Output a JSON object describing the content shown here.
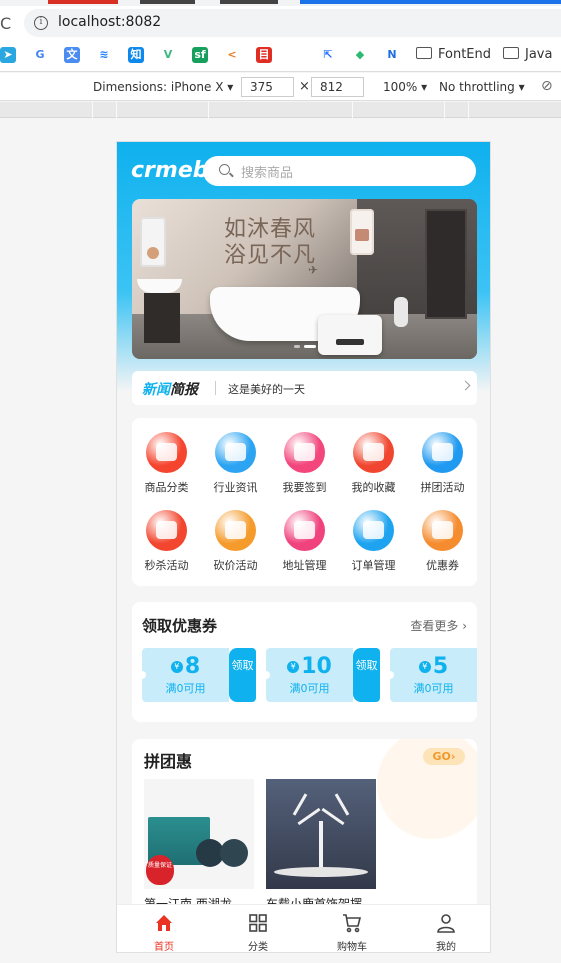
{
  "browser": {
    "url": "localhost:8082",
    "bookmarks": [
      "FontEnd",
      "Java"
    ]
  },
  "devtools": {
    "device_label": "Dimensions: iPhone X ▾",
    "width": "375",
    "times": "×",
    "height": "812",
    "zoom": "100% ▾",
    "throttle": "No throttling ▾"
  },
  "app": {
    "logo": "crmeb",
    "search": {
      "placeholder": "搜索商品"
    },
    "banner": {
      "line1": "如沐春风",
      "line2": "浴见不凡"
    },
    "news": {
      "brand_a": "新闻",
      "brand_b": "简报",
      "text": "这是美好的一天"
    },
    "menu": [
      {
        "label": "商品分类",
        "color": "#f5452f",
        "icon": "bag-icon"
      },
      {
        "label": "行业资讯",
        "color": "#2ca4f2",
        "icon": "news-doc-icon"
      },
      {
        "label": "我要签到",
        "color": "#f2467c",
        "icon": "calendar-icon"
      },
      {
        "label": "我的收藏",
        "color": "#f0462f",
        "icon": "crown-icon"
      },
      {
        "label": "拼团活动",
        "color": "#1f9af0",
        "icon": "megaphone-icon"
      },
      {
        "label": "秒杀活动",
        "color": "#f2462f",
        "icon": "flash-icon"
      },
      {
        "label": "砍价活动",
        "color": "#f59b2c",
        "icon": "discount-tag-icon"
      },
      {
        "label": "地址管理",
        "color": "#f0427c",
        "icon": "location-icon"
      },
      {
        "label": "订单管理",
        "color": "#1da3f0",
        "icon": "order-list-icon"
      },
      {
        "label": "优惠券",
        "color": "#f58c2f",
        "icon": "coupon-icon"
      }
    ],
    "coupons": {
      "title": "领取优惠券",
      "more": "查看更多",
      "items": [
        {
          "currency": "¥",
          "amount": "8",
          "condition": "满0可用",
          "button": "领取"
        },
        {
          "currency": "¥",
          "amount": "10",
          "condition": "满0可用",
          "button": "领取"
        },
        {
          "currency": "¥",
          "amount": "5",
          "condition": "满0可用",
          "button": "领取"
        }
      ]
    },
    "group": {
      "title": "拼团惠",
      "go": "GO",
      "products": [
        {
          "name": "第一江南 西湖龙",
          "badge": "质量保证"
        },
        {
          "name": "车载小鹿首饰架摆"
        }
      ]
    },
    "tabbar": [
      {
        "label": "首页",
        "icon": "home-icon",
        "active": true
      },
      {
        "label": "分类",
        "icon": "grid-icon"
      },
      {
        "label": "购物车",
        "icon": "cart-icon"
      },
      {
        "label": "我的",
        "icon": "user-icon"
      }
    ],
    "colors": {
      "primary": "#0fb1ee",
      "active_tab": "#e93323"
    }
  }
}
